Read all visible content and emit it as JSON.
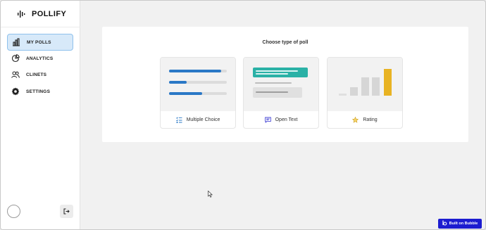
{
  "brand": {
    "name": "POLLIFY",
    "logo_icon": "soundwave-icon"
  },
  "sidebar": {
    "items": [
      {
        "label": "MY POLLS",
        "icon": "bar-chart-icon",
        "active": true
      },
      {
        "label": "ANALYTICS",
        "icon": "pie-chart-icon",
        "active": false
      },
      {
        "label": "CLINETS",
        "icon": "users-icon",
        "active": false
      },
      {
        "label": "SETTINGS",
        "icon": "gear-icon",
        "active": false
      }
    ],
    "logout_icon": "logout-icon"
  },
  "main": {
    "title": "Choose type of poll",
    "options": [
      {
        "label": "Multiple Choice",
        "icon": "list-check-icon"
      },
      {
        "label": "Open Text",
        "icon": "message-icon"
      },
      {
        "label": "Rating",
        "icon": "star-icon"
      }
    ],
    "multiple_choice_fills": [
      0.9,
      0.3,
      0.57
    ]
  },
  "badge": {
    "label": "Built on Bubble",
    "icon": "bubble-logo-icon"
  },
  "colors": {
    "accent_blue": "#2a78c6",
    "teal": "#2ab1a6",
    "gold": "#e8b323",
    "active_bg": "#d7e9f9",
    "badge_bg": "#1d1dd0"
  }
}
